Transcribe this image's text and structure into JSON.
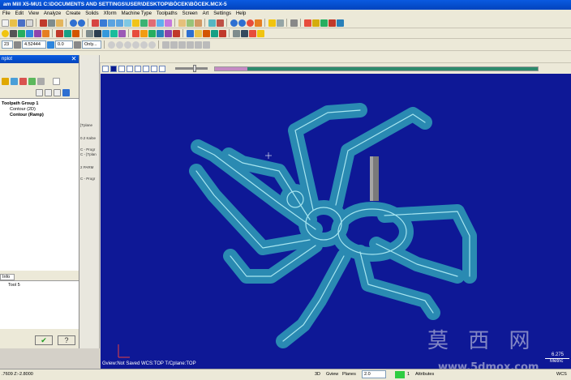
{
  "window": {
    "title": "am Mill X5-MU1  C:\\DOCUMENTS AND SETTINGS\\USER\\DESKTOP\\BÖCEK\\BÖCEK.MCX-5"
  },
  "menu": [
    "File",
    "Edit",
    "View",
    "Analyze",
    "Create",
    "Solids",
    "Xform",
    "Machine Type",
    "Toolpaths",
    "Screen",
    "Art",
    "Settings",
    "Help"
  ],
  "toolbar3": {
    "field_a": "23",
    "field_b": "4.52444",
    "field_c": "0.0",
    "level": "Only..."
  },
  "panel": {
    "title": "nplot",
    "close": "✕",
    "tree": [
      {
        "label": "Toolpath Group 1",
        "bold": true
      },
      {
        "label": "Contour (2D)",
        "bold": false
      },
      {
        "label": "Contour (Ramp)",
        "bold": true
      }
    ],
    "info_tab": "Info",
    "info_text": "Tool 5",
    "ok": "✔",
    "help": "?"
  },
  "mid_strip": [
    "[Tplane",
    "0.2 Kalöe",
    "C - Progr",
    "C - [Tplan",
    "2 PARM",
    "C - Progr"
  ],
  "viewport": {
    "status": "Gview:Not Saved   WCS:TOP   T/Cplane:TOP",
    "scale_value": "6.275",
    "scale_unit": "Metric"
  },
  "statusbar": {
    "coords": ".7609  Z:-2.8000",
    "mode": "3D",
    "gview": "Gview",
    "planes": "Planes",
    "z_value": "2.0",
    "level_value": "1",
    "attributes": "Attributes",
    "wcs": "WCS"
  },
  "watermark": {
    "text": "莫 西 网",
    "url": "www.5dmox.com"
  },
  "colors": {
    "viewport_bg": "#0e1896",
    "toolpath_glow": "#2f9fb8",
    "titlebar": "#0244bd"
  }
}
